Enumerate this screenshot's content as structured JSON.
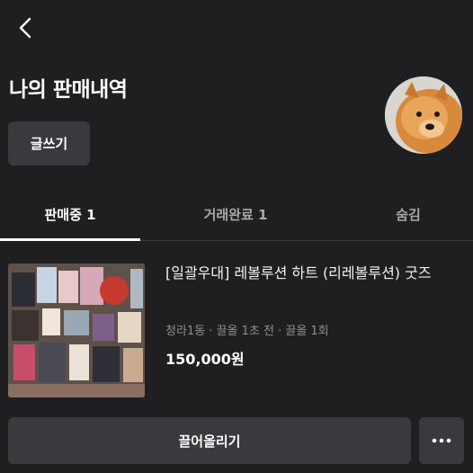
{
  "header": {
    "back_icon": "chevron-left-icon",
    "title": "나의 판매내역"
  },
  "actions": {
    "write_label": "글쓰기"
  },
  "tabs": [
    {
      "label": "판매중 1",
      "active": true
    },
    {
      "label": "거래완료 1",
      "active": false
    },
    {
      "label": "숨김",
      "active": false
    }
  ],
  "listing": {
    "title": "[일괄우대] 레볼루션 하트 (리레볼루션) 굿즈",
    "location": "청라1동",
    "bump_time": "끌올 1초 전",
    "bump_count": "끌올 1회",
    "price": "150,000원",
    "bump_button_label": "끌어올리기",
    "more_icon": "more-horizontal-icon"
  },
  "colors": {
    "background": "#1f1f22",
    "button": "#3a3a3e",
    "text_muted": "#8e8e93"
  }
}
